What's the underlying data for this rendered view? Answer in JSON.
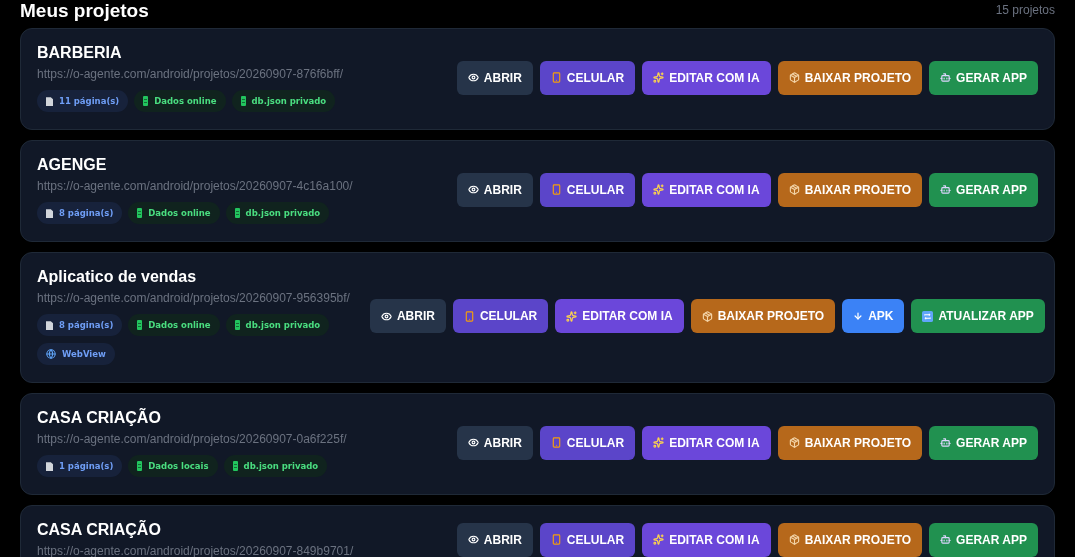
{
  "header": {
    "title": "Meus projetos",
    "count": "15 projetos"
  },
  "projects": [
    {
      "name": "BARBERIA",
      "url": "https://o-agente.com/android/projetos/20260907-876f6bff/",
      "badges": [
        {
          "kind": "pages",
          "label": "11 página(s)"
        },
        {
          "kind": "data",
          "label": "Dados online"
        },
        {
          "kind": "db",
          "label": "db.json privado"
        }
      ],
      "actions": [
        {
          "kind": "open",
          "label": "ABRIR"
        },
        {
          "kind": "phone",
          "label": "CELULAR"
        },
        {
          "kind": "ai",
          "label": "EDITAR COM IA"
        },
        {
          "kind": "download",
          "label": "BAIXAR PROJETO"
        },
        {
          "kind": "build",
          "label": "GERAR APP"
        }
      ]
    },
    {
      "name": "AGENGE",
      "url": "https://o-agente.com/android/projetos/20260907-4c16a100/",
      "badges": [
        {
          "kind": "pages",
          "label": "8 página(s)"
        },
        {
          "kind": "data",
          "label": "Dados online"
        },
        {
          "kind": "db",
          "label": "db.json privado"
        }
      ],
      "actions": [
        {
          "kind": "open",
          "label": "ABRIR"
        },
        {
          "kind": "phone",
          "label": "CELULAR"
        },
        {
          "kind": "ai",
          "label": "EDITAR COM IA"
        },
        {
          "kind": "download",
          "label": "BAIXAR PROJETO"
        },
        {
          "kind": "build",
          "label": "GERAR APP"
        }
      ]
    },
    {
      "name": "Aplicatico de vendas",
      "url": "https://o-agente.com/android/projetos/20260907-956395bf/",
      "badges": [
        {
          "kind": "pages",
          "label": "8 página(s)"
        },
        {
          "kind": "data",
          "label": "Dados online"
        },
        {
          "kind": "db",
          "label": "db.json privado"
        },
        {
          "kind": "webview",
          "label": "WebView"
        }
      ],
      "actions": [
        {
          "kind": "open",
          "label": "ABRIR"
        },
        {
          "kind": "phone",
          "label": "CELULAR"
        },
        {
          "kind": "ai",
          "label": "EDITAR COM IA"
        },
        {
          "kind": "download",
          "label": "BAIXAR PROJETO"
        },
        {
          "kind": "apk",
          "label": "APK"
        },
        {
          "kind": "update",
          "label": "ATUALIZAR APP"
        }
      ]
    },
    {
      "name": "CASA CRIAÇÃO",
      "url": "https://o-agente.com/android/projetos/20260907-0a6f225f/",
      "badges": [
        {
          "kind": "pages",
          "label": "1 página(s)"
        },
        {
          "kind": "data",
          "label": "Dados locais"
        },
        {
          "kind": "db",
          "label": "db.json privado"
        }
      ],
      "actions": [
        {
          "kind": "open",
          "label": "ABRIR"
        },
        {
          "kind": "phone",
          "label": "CELULAR"
        },
        {
          "kind": "ai",
          "label": "EDITAR COM IA"
        },
        {
          "kind": "download",
          "label": "BAIXAR PROJETO"
        },
        {
          "kind": "build",
          "label": "GERAR APP"
        }
      ]
    },
    {
      "name": "CASA CRIAÇÃO",
      "url": "https://o-agente.com/android/projetos/20260907-849b9701/",
      "actions": [
        {
          "kind": "open",
          "label": "ABRIR"
        },
        {
          "kind": "phone",
          "label": "CELULAR"
        },
        {
          "kind": "ai",
          "label": "EDITAR COM IA"
        },
        {
          "kind": "download",
          "label": "BAIXAR PROJETO"
        },
        {
          "kind": "build",
          "label": "GERAR APP"
        }
      ]
    }
  ]
}
